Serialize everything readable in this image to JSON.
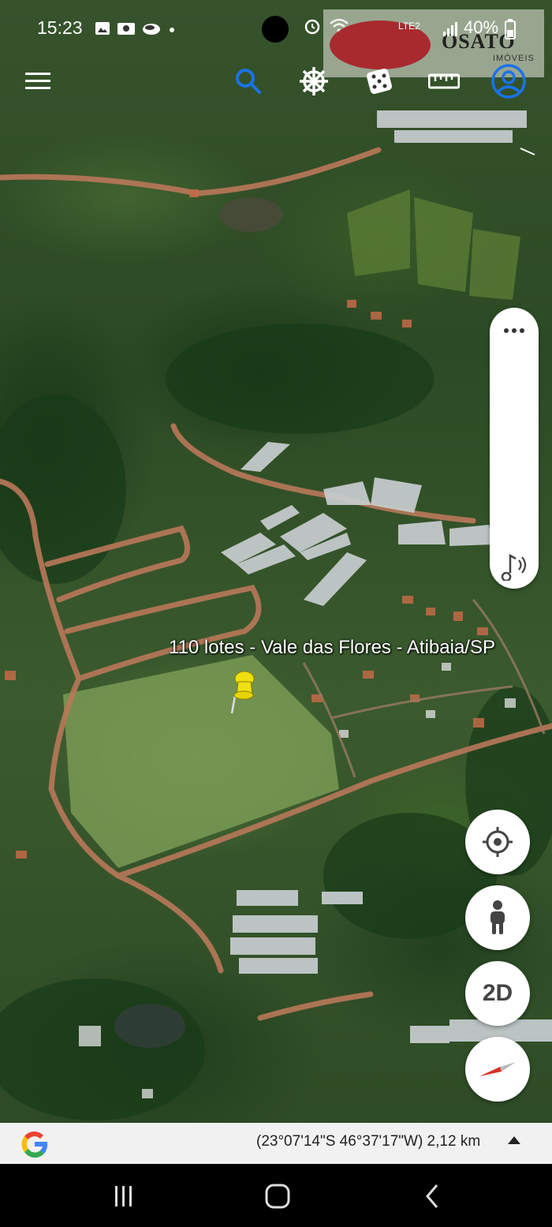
{
  "status_bar": {
    "time": "15:23",
    "battery": "40%",
    "network": "LTE2",
    "icons": [
      "gallery-icon",
      "photo-icon",
      "cloud-icon",
      "dot-icon",
      "alarm-icon",
      "wifi-icon",
      "signal-icon",
      "battery-icon"
    ]
  },
  "watermark": {
    "name": "OSATO",
    "sub": "IMÓVEIS"
  },
  "toolbar": {
    "icons": [
      "menu-icon",
      "search-icon",
      "voyager-wheel-icon",
      "dice-icon",
      "ruler-icon",
      "account-icon"
    ],
    "accent_color": "#1a73e8"
  },
  "placemark": {
    "label": "110 lotes - Vale das Flores - Atibaia/SP",
    "pin_color": "#f0e010"
  },
  "side_panel": {
    "more_icon": "more-dots-icon",
    "audio_icon": "audio-tour-icon"
  },
  "buttons": {
    "my_location": "my-location-icon",
    "street_view": "pegman-icon",
    "view_mode": "2D",
    "compass": "compass-icon"
  },
  "info_bar": {
    "coordinates": "(23°07'14\"S 46°37'17\"W) 2,12 km",
    "logo": "google-g-icon"
  },
  "nav_bar": {
    "icons": [
      "recents-icon",
      "home-icon",
      "back-icon"
    ]
  }
}
